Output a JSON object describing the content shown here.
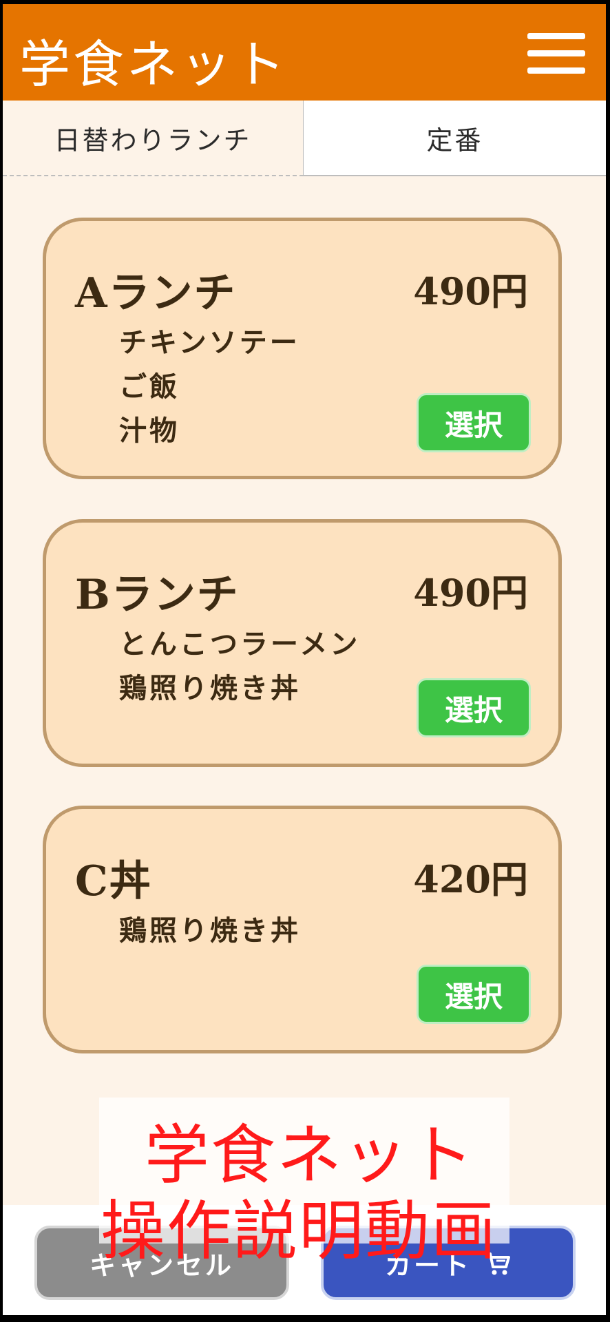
{
  "header": {
    "title": "学食ネット",
    "menu_icon": "hamburger-menu-icon",
    "color": "#e57400"
  },
  "tabs": [
    {
      "label": "日替わりランチ",
      "active": true
    },
    {
      "label": "定番",
      "active": false
    }
  ],
  "menu": [
    {
      "name": "Aランチ",
      "price": "490円",
      "items": [
        "チキンソテー",
        "ご飯",
        "汁物"
      ],
      "button": "選択"
    },
    {
      "name": "Bランチ",
      "price": "490円",
      "items": [
        "とんこつラーメン",
        "鶏照り焼き丼"
      ],
      "button": "選択"
    },
    {
      "name": "C丼",
      "price": "420円",
      "items": [
        "鶏照り焼き丼"
      ],
      "button": "選択"
    }
  ],
  "footer": {
    "cancel_label": "キャンセル",
    "cart_label": "カート",
    "cart_icon": "cart-icon"
  },
  "overlay": {
    "line1": "学食ネット",
    "line2": "操作説明動画",
    "color": "#ff1a1a"
  }
}
